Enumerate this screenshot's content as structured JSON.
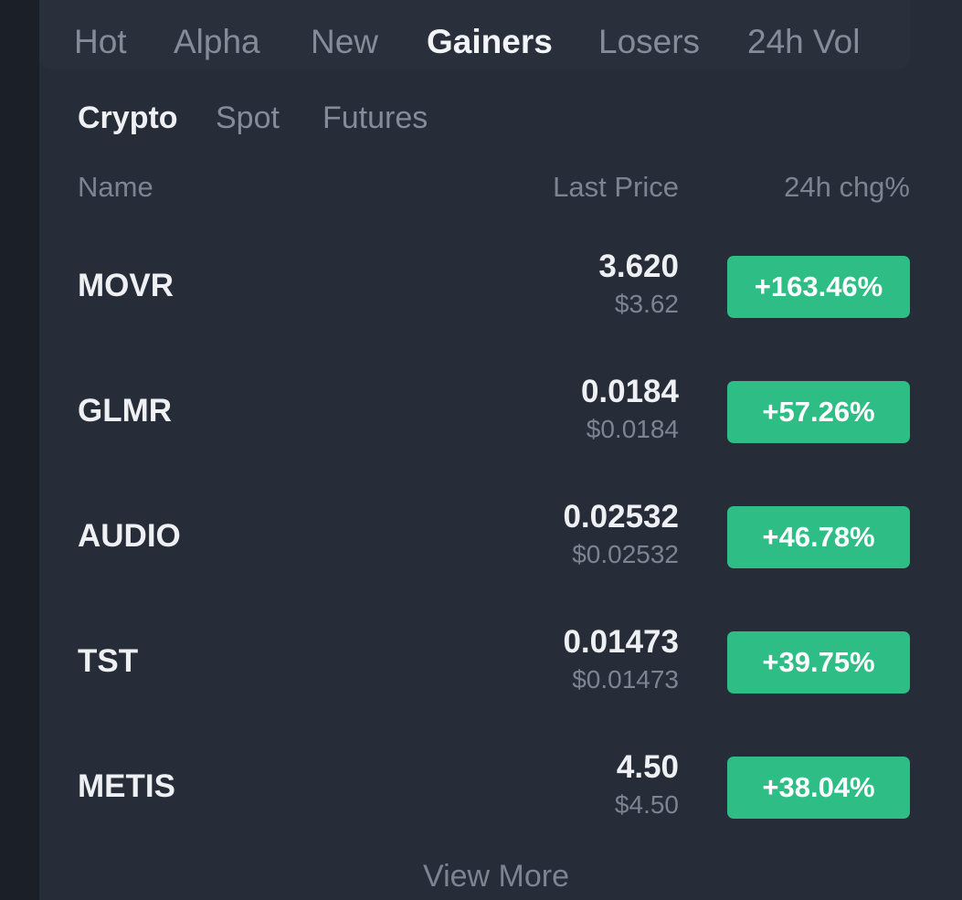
{
  "tabs": [
    "Hot",
    "Alpha",
    "New",
    "Gainers",
    "Losers",
    "24h Vol"
  ],
  "subtabs": [
    "Crypto",
    "Spot",
    "Futures"
  ],
  "columns": {
    "name": "Name",
    "last_price": "Last Price",
    "change": "24h chg%"
  },
  "rows": [
    {
      "name": "MOVR",
      "price": "3.620",
      "usd": "$3.62",
      "change": "+163.46%"
    },
    {
      "name": "GLMR",
      "price": "0.0184",
      "usd": "$0.0184",
      "change": "+57.26%"
    },
    {
      "name": "AUDIO",
      "price": "0.02532",
      "usd": "$0.02532",
      "change": "+46.78%"
    },
    {
      "name": "TST",
      "price": "0.01473",
      "usd": "$0.01473",
      "change": "+39.75%"
    },
    {
      "name": "METIS",
      "price": "4.50",
      "usd": "$4.50",
      "change": "+38.04%"
    }
  ],
  "view_more": "View More",
  "colors": {
    "background": "#1b2028",
    "panel": "#262d38",
    "positive": "#2ebd85",
    "text_primary": "#eef0f3",
    "text_secondary": "#7c8491"
  }
}
